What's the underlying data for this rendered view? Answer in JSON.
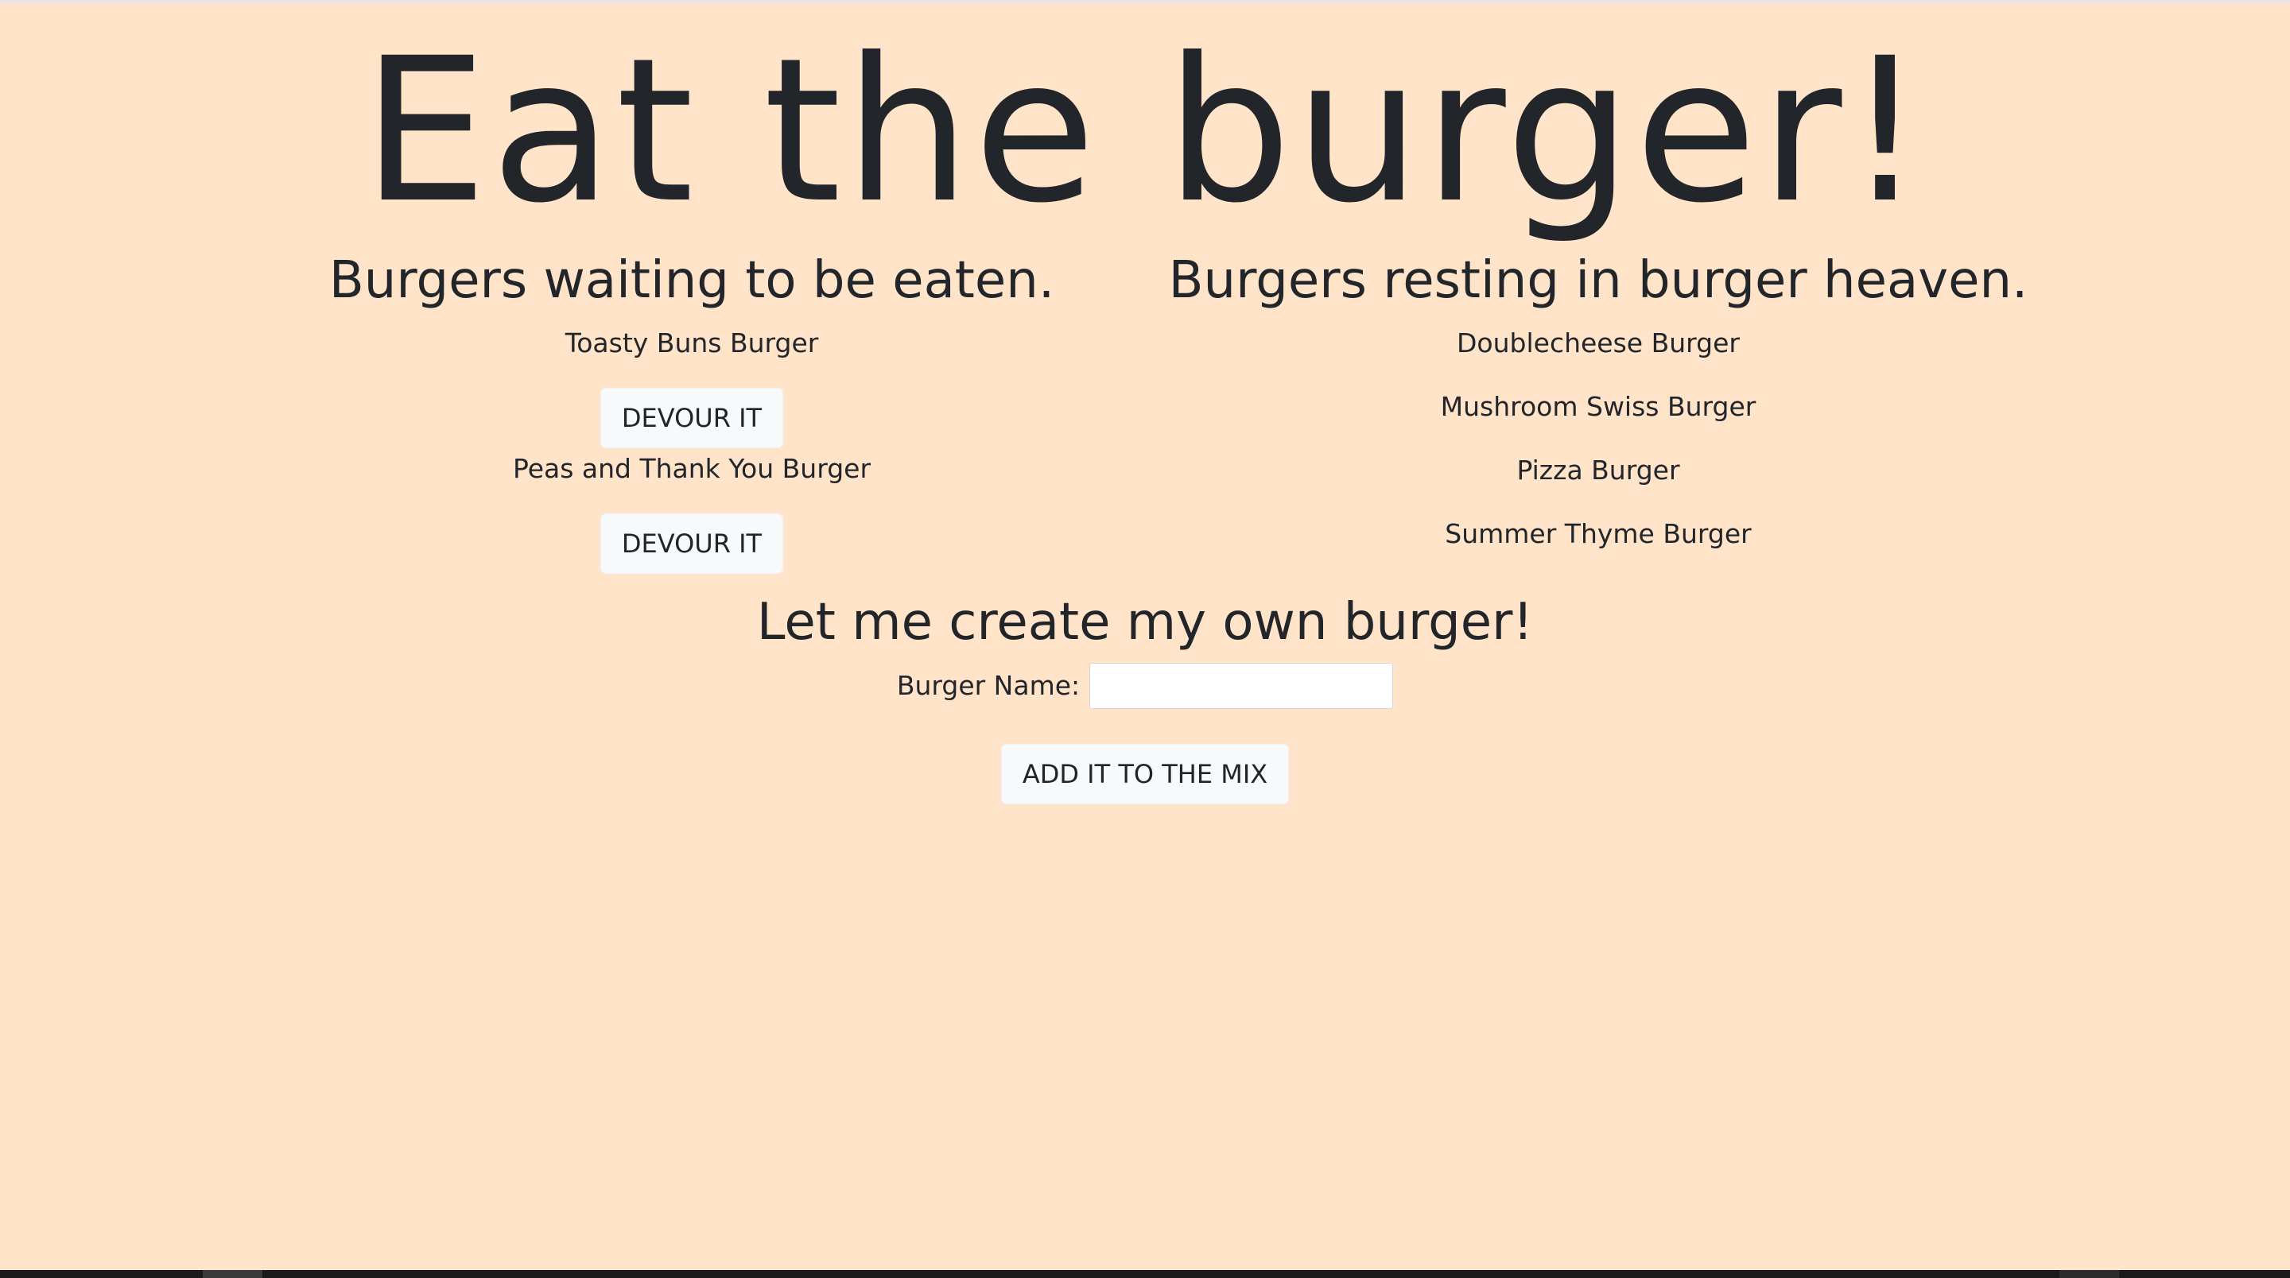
{
  "header": {
    "title": "Eat the burger!"
  },
  "waiting": {
    "heading": "Burgers waiting to be eaten.",
    "items": [
      {
        "name": "Toasty Buns Burger",
        "button_label": "DEVOUR IT"
      },
      {
        "name": "Peas and Thank You Burger",
        "button_label": "DEVOUR IT"
      }
    ]
  },
  "devoured": {
    "heading": "Burgers resting in burger heaven.",
    "items": [
      {
        "name": "Doublecheese Burger"
      },
      {
        "name": "Mushroom Swiss Burger"
      },
      {
        "name": "Pizza Burger"
      },
      {
        "name": "Summer Thyme Burger"
      }
    ]
  },
  "create": {
    "heading": "Let me create my own burger!",
    "field_label": "Burger Name:",
    "field_value": "",
    "submit_label": "ADD IT TO THE MIX"
  },
  "colors": {
    "background": "#ffe4c9",
    "text": "#222529",
    "button_bg": "#f8f9fa"
  }
}
